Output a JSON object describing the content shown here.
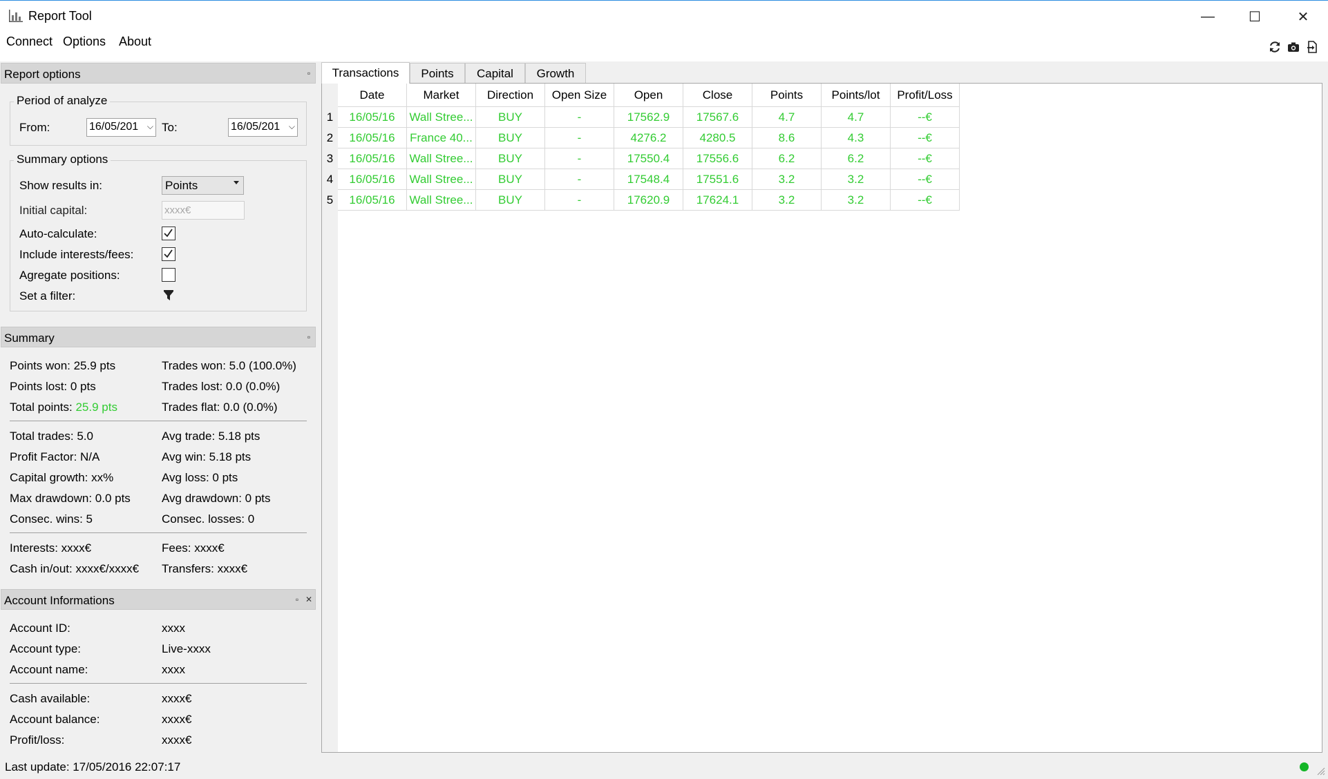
{
  "window": {
    "title": "Report Tool",
    "minimize": "—",
    "maximize": "☐",
    "close": "✕"
  },
  "menu": [
    "Connect",
    "Options",
    "About"
  ],
  "toolbar_icons": [
    "refresh-icon",
    "camera-icon",
    "export-icon"
  ],
  "report_options": {
    "title": "Report options",
    "period": {
      "title": "Period of analyze",
      "from_label": "From:",
      "from_value": "16/05/201",
      "to_label": "To:",
      "to_value": "16/05/201"
    },
    "summary_options": {
      "title": "Summary options",
      "show_results_label": "Show results in:",
      "show_results_value": "Points",
      "initial_capital_label": "Initial capital:",
      "initial_capital_placeholder": "xxxx€",
      "auto_calculate_label": "Auto-calculate:",
      "auto_calculate": true,
      "include_interests_label": "Include interests/fees:",
      "include_interests": true,
      "aggregate_label": "Agregate positions:",
      "aggregate": false,
      "filter_label": "Set a filter:"
    }
  },
  "summary": {
    "title": "Summary",
    "points_won": "Points won: 25.9 pts",
    "trades_won": "Trades won: 5.0 (100.0%)",
    "points_lost": "Points lost: 0 pts",
    "trades_lost": "Trades lost: 0.0 (0.0%)",
    "total_points_label": "Total points:",
    "total_points_value": "25.9 pts",
    "trades_flat": "Trades flat: 0.0 (0.0%)",
    "total_trades": "Total trades: 5.0",
    "avg_trade": "Avg trade: 5.18 pts",
    "profit_factor": "Profit Factor: N/A",
    "avg_win": "Avg win: 5.18 pts",
    "capital_growth": "Capital growth: xx%",
    "avg_loss": "Avg loss: 0 pts",
    "max_drawdown": "Max drawdown: 0.0 pts",
    "avg_drawdown": "Avg drawdown: 0 pts",
    "consec_wins": "Consec. wins: 5",
    "consec_losses": "Consec. losses: 0",
    "interests": "Interests: xxxx€",
    "fees": "Fees: xxxx€",
    "cash_inout": "Cash in/out: xxxx€/xxxx€",
    "transfers": "Transfers: xxxx€"
  },
  "account": {
    "title": "Account Informations",
    "id_label": "Account ID:",
    "id_value": "xxxx",
    "type_label": "Account type:",
    "type_value": "Live-xxxx",
    "name_label": "Account name:",
    "name_value": "xxxx",
    "cash_label": "Cash available:",
    "cash_value": "xxxx€",
    "balance_label": "Account balance:",
    "balance_value": "xxxx€",
    "pl_label": "Profit/loss:",
    "pl_value": "xxxx€"
  },
  "status": {
    "last_update": "Last update: 17/05/2016 22:07:17",
    "connection_color": "#13b526"
  },
  "tabs": [
    "Transactions",
    "Points",
    "Capital",
    "Growth"
  ],
  "active_tab": "Transactions",
  "table": {
    "columns": [
      "Date",
      "Market",
      "Direction",
      "Open Size",
      "Open",
      "Close",
      "Points",
      "Points/lot",
      "Profit/Loss"
    ],
    "rows": [
      {
        "num": "1",
        "cells": [
          "16/05/16",
          "Wall Stree...",
          "BUY",
          "-",
          "17562.9",
          "17567.6",
          "4.7",
          "4.7",
          "--€"
        ]
      },
      {
        "num": "2",
        "cells": [
          "16/05/16",
          "France 40...",
          "BUY",
          "-",
          "4276.2",
          "4280.5",
          "8.6",
          "4.3",
          "--€"
        ]
      },
      {
        "num": "3",
        "cells": [
          "16/05/16",
          "Wall Stree...",
          "BUY",
          "-",
          "17550.4",
          "17556.6",
          "6.2",
          "6.2",
          "--€"
        ]
      },
      {
        "num": "4",
        "cells": [
          "16/05/16",
          "Wall Stree...",
          "BUY",
          "-",
          "17548.4",
          "17551.6",
          "3.2",
          "3.2",
          "--€"
        ]
      },
      {
        "num": "5",
        "cells": [
          "16/05/16",
          "Wall Stree...",
          "BUY",
          "-",
          "17620.9",
          "17624.1",
          "3.2",
          "3.2",
          "--€"
        ]
      }
    ]
  },
  "colors": {
    "profit_text": "#33cc33",
    "dock_title_bg": "#d6d6d6",
    "window_bg": "#f0f0f0"
  }
}
